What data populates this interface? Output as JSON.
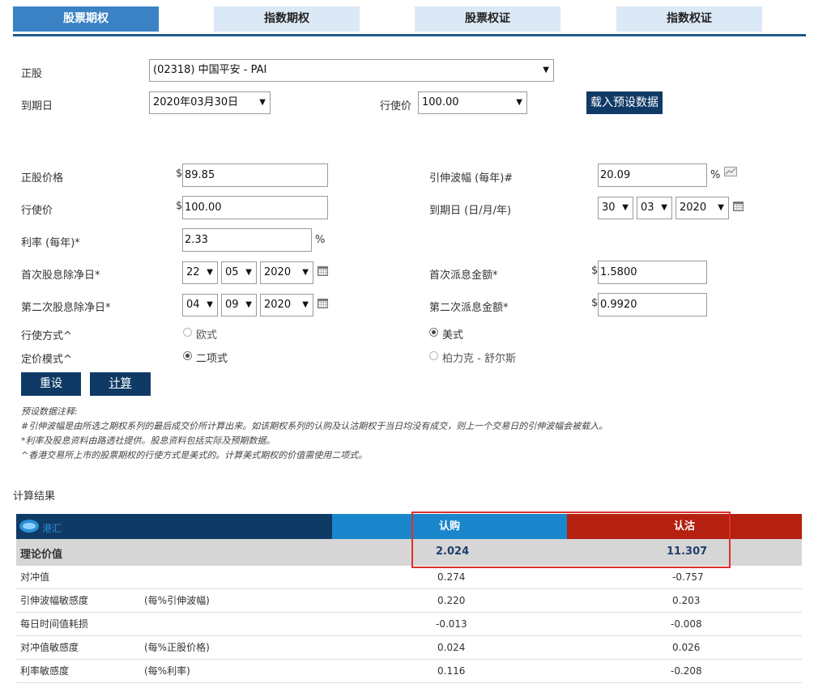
{
  "tabs": [
    {
      "label": "股票期权",
      "active": true
    },
    {
      "label": "指数期权",
      "active": false
    },
    {
      "label": "股票权证",
      "active": false
    },
    {
      "label": "指数权证",
      "active": false
    }
  ],
  "selectors": {
    "underlying_label": "正股",
    "underlying_value": "(02318) 中国平安 - PAI",
    "expiry_label": "到期日",
    "expiry_value": "2020年03月30日",
    "strike_label": "行使价",
    "strike_value": "100.00",
    "load_button": "载入预设数据"
  },
  "form": {
    "stock_price_label": "正股价格",
    "stock_price_currency": "$",
    "stock_price_value": "89.85",
    "strike_label": "行使价",
    "strike_currency": "$",
    "strike_value": "100.00",
    "rate_label": "利率 (每年)*",
    "rate_value": "2.33",
    "rate_unit": "%",
    "first_exdate_label": "首次股息除净日*",
    "first_exdate": {
      "day": "22",
      "month": "05",
      "year": "2020"
    },
    "second_exdate_label": "第二次股息除净日*",
    "second_exdate": {
      "day": "04",
      "month": "09",
      "year": "2020"
    },
    "exercise_label": "行使方式^",
    "exercise_options": [
      "欧式",
      "美式"
    ],
    "exercise_selected": "美式",
    "pricing_label": "定价模式^",
    "pricing_options": [
      "二项式",
      "柏力克 - 舒尔斯"
    ],
    "pricing_selected": "二项式",
    "iv_label": "引伸波幅 (每年)#",
    "iv_value": "20.09",
    "iv_unit": "%",
    "expiry_label": "到期日 (日/月/年)",
    "expiry_date": {
      "day": "30",
      "month": "03",
      "year": "2020"
    },
    "first_div_label": "首次派息金额*",
    "first_div_currency": "$",
    "first_div_value": "1.5800",
    "second_div_label": "第二次派息金额*",
    "second_div_currency": "$",
    "second_div_value": "0.9920",
    "reset_button": "重设",
    "calc_button": "计算"
  },
  "notes": [
    "预设数据注释:",
    "#引伸波幅是由所选之期权系列的最后成交价所计算出来。如该期权系列的认购及认沽期权于当日均没有成交，则上一个交易日的引伸波幅会被载入。",
    "*利率及股息资料由路透社提供。股息资料包括实际及预期数据。",
    "^香港交易所上市的股票期权的行使方式是美式的。计算美式期权的价值需使用二项式。"
  ],
  "results": {
    "section_title": "计算结果",
    "brand": "港汇",
    "call_header": "认购",
    "put_header": "认沽",
    "theoretical_label": "理论价值",
    "theoretical_call": "2.024",
    "theoretical_put": "11.307",
    "rows": [
      {
        "label": "对冲值",
        "note": "",
        "call": "0.274",
        "put": "-0.757"
      },
      {
        "label": "引伸波幅敏感度",
        "note": "(每%引伸波幅)",
        "call": "0.220",
        "put": "0.203"
      },
      {
        "label": "每日时间值耗损",
        "note": "",
        "call": "-0.013",
        "put": "-0.008"
      },
      {
        "label": "对冲值敏感度",
        "note": "(每%正股价格)",
        "call": "0.024",
        "put": "0.026"
      },
      {
        "label": "利率敏感度",
        "note": "(每%利率)",
        "call": "0.116",
        "put": "-0.208"
      }
    ]
  },
  "colors": {
    "tab_active": "#3a82c4",
    "tab_inactive": "#dbe9f6",
    "navy": "#103a66",
    "call_blue": "#1a86cc",
    "put_red": "#b52010",
    "highlight_box": "#e0302a"
  }
}
